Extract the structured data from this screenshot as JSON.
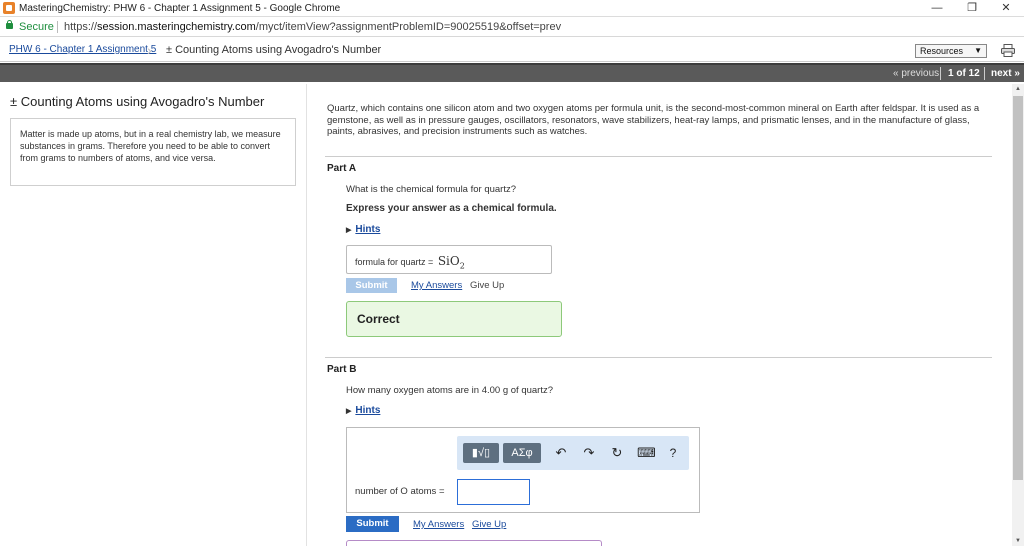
{
  "window": {
    "title": "MasteringChemistry: PHW 6 - Chapter 1 Assignment 5 - Google Chrome",
    "minimize": "—",
    "restore": "❐",
    "close": "✕"
  },
  "address_bar": {
    "secure_label": "Secure",
    "url_scheme": "https://",
    "url_host": "session.masteringchemistry.com",
    "url_path": "/myct/itemView?assignmentProblemID=90025519&offset=prev"
  },
  "breadcrumb": {
    "assignment_link": "PHW 6 - Chapter 1 Assignment 5",
    "current": "± Counting Atoms using Avogadro's Number",
    "resources_label": "Resources"
  },
  "nav": {
    "previous": "« previous",
    "count": "1 of 12",
    "next": "next »"
  },
  "sidebar": {
    "title": "± Counting Atoms using Avogadro's Number",
    "intro": "Matter is made up atoms, but in a real chemistry lab, we measure substances in grams. Therefore you need to be able to convert from grams to numbers of atoms, and vice versa."
  },
  "main": {
    "intro": "Quartz, which contains one silicon atom and two oxygen atoms per formula unit, is the second-most-common mineral on Earth after feldspar. It is used as a gemstone, as well as in pressure gauges, oscillators, resonators, wave stabilizers, heat-ray lamps, and prismatic lenses, and in the manufacture of glass, paints, abrasives, and precision instruments such as watches.",
    "part_a": {
      "heading": "Part A",
      "question": "What is the chemical formula for quartz?",
      "instruction": "Express your answer as a chemical formula.",
      "hints": "Hints",
      "answer_label": "formula for quartz =",
      "answer_base": "SiO",
      "answer_sub": "2",
      "submit": "Submit",
      "my_answers": "My Answers",
      "give_up": "Give Up",
      "result": "Correct"
    },
    "part_b": {
      "heading": "Part B",
      "question": "How many oxygen atoms are in 4.00 g of quartz?",
      "hints": "Hints",
      "toolbar": {
        "templates": "▮√▯",
        "greek": "ΑΣφ",
        "undo": "↶",
        "redo": "↷",
        "reset": "↻",
        "keyboard": "⌨",
        "help": "?"
      },
      "answer_label": "number of O atoms =",
      "answer_value": "",
      "submit": "Submit",
      "my_answers": "My Answers",
      "give_up": "Give Up"
    }
  },
  "colors": {
    "link": "#1a4a9c",
    "submit_active": "#2b6cc4",
    "submit_disabled": "#a9c7e8",
    "correct_bg": "#eaf8e3",
    "nav_bar": "#5a5a5a"
  }
}
